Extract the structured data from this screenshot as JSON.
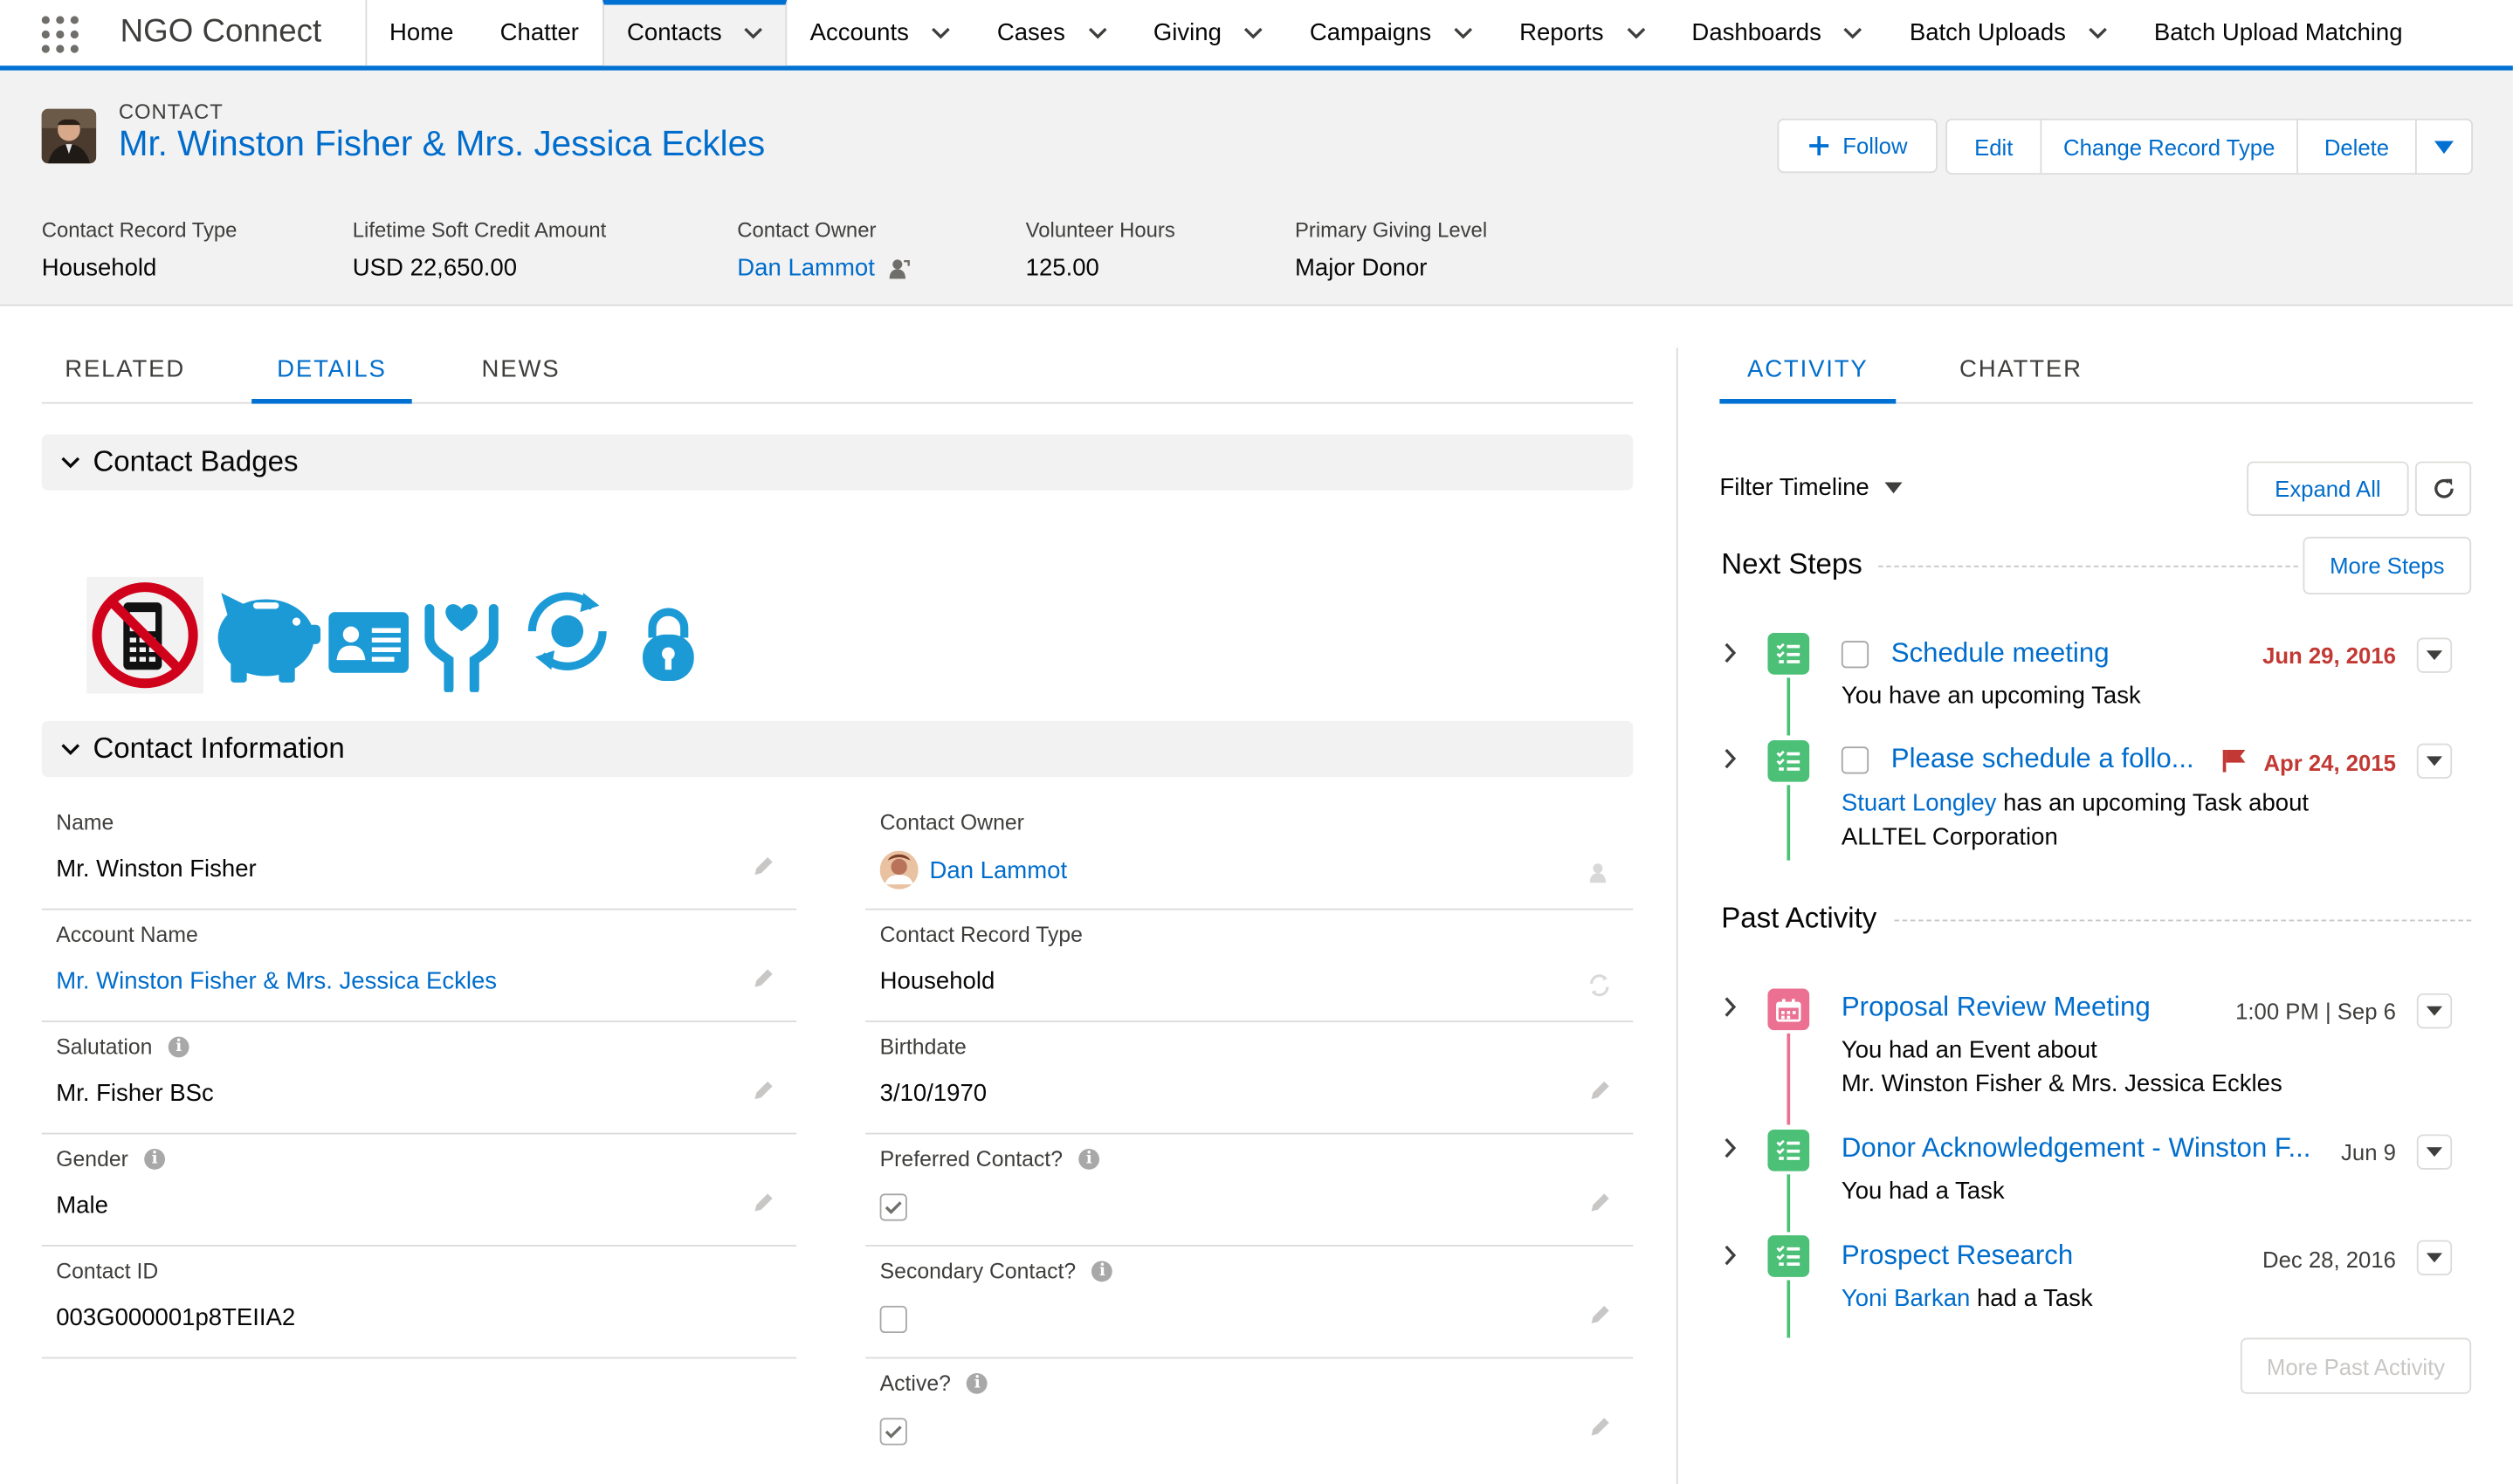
{
  "app": {
    "name": "NGO Connect"
  },
  "nav": {
    "items": [
      {
        "label": "Home",
        "dropdown": false
      },
      {
        "label": "Chatter",
        "dropdown": false
      },
      {
        "label": "Contacts",
        "dropdown": true,
        "active": true
      },
      {
        "label": "Accounts",
        "dropdown": true
      },
      {
        "label": "Cases",
        "dropdown": true
      },
      {
        "label": "Giving",
        "dropdown": true
      },
      {
        "label": "Campaigns",
        "dropdown": true
      },
      {
        "label": "Reports",
        "dropdown": true
      },
      {
        "label": "Dashboards",
        "dropdown": true
      },
      {
        "label": "Batch Uploads",
        "dropdown": true
      },
      {
        "label": "Batch Upload Matching",
        "dropdown": false
      }
    ]
  },
  "record": {
    "type_label": "CONTACT",
    "name": "Mr. Winston Fisher & Mrs. Jessica Eckles",
    "actions": {
      "follow": "Follow",
      "edit": "Edit",
      "change_record_type": "Change Record Type",
      "delete": "Delete"
    }
  },
  "highlights": [
    {
      "label": "Contact Record Type",
      "value": "Household"
    },
    {
      "label": "Lifetime Soft Credit Amount",
      "value": "USD 22,650.00"
    },
    {
      "label": "Contact Owner",
      "value": "Dan Lammot"
    },
    {
      "label": "Volunteer Hours",
      "value": "125.00"
    },
    {
      "label": "Primary Giving Level",
      "value": "Major Donor"
    }
  ],
  "left_tabs": [
    {
      "label": "RELATED"
    },
    {
      "label": "DETAILS",
      "active": true
    },
    {
      "label": "NEWS"
    }
  ],
  "sections": {
    "badges": "Contact Badges",
    "info": "Contact Information"
  },
  "badges": [
    "no-mobile-icon",
    "piggy-bank-icon",
    "id-card-icon",
    "charity-hands-icon",
    "recurring-sync-icon",
    "lock-icon"
  ],
  "fields": {
    "name": {
      "label": "Name",
      "value": "Mr. Winston Fisher"
    },
    "owner": {
      "label": "Contact Owner",
      "value": "Dan Lammot"
    },
    "account": {
      "label": "Account Name",
      "value": "Mr. Winston Fisher & Mrs. Jessica Eckles"
    },
    "record_type": {
      "label": "Contact Record Type",
      "value": "Household"
    },
    "salutation": {
      "label": "Salutation",
      "value": "Mr. Fisher BSc"
    },
    "birthdate": {
      "label": "Birthdate",
      "value": "3/10/1970"
    },
    "gender": {
      "label": "Gender",
      "value": "Male"
    },
    "preferred": {
      "label": "Preferred Contact?",
      "checked": true
    },
    "contact_id": {
      "label": "Contact ID",
      "value": "003G000001p8TEIIA2"
    },
    "secondary": {
      "label": "Secondary Contact?",
      "checked": false
    },
    "active": {
      "label": "Active?",
      "checked": true
    }
  },
  "right_tabs": [
    {
      "label": "ACTIVITY",
      "active": true
    },
    {
      "label": "CHATTER"
    }
  ],
  "activity": {
    "filter": "Filter Timeline",
    "expand_all": "Expand All",
    "next_steps": "Next Steps",
    "more_steps": "More Steps",
    "past_activity": "Past Activity",
    "more_past": "More Past Activity",
    "upcoming": [
      {
        "title": "Schedule meeting",
        "date": "Jun 29, 2016",
        "sub": "You have an upcoming Task"
      },
      {
        "title": "Please schedule a follo...",
        "date": "Apr 24, 2015",
        "sub_link": "Stuart Longley",
        "sub_text": "has an upcoming Task about",
        "sub_link2": "ALLTEL Corporation"
      }
    ],
    "past": [
      {
        "title": "Proposal Review Meeting",
        "date": "1:00 PM | Sep 6",
        "sub": "You had an Event about",
        "sub_link": "Mr. Winston Fisher & Mrs. Jessica Eckles"
      },
      {
        "title": "Donor Acknowledgement - Winston F...",
        "date": "Jun 9",
        "sub": "You had a Task"
      },
      {
        "title": "Prospect Research",
        "date": "Dec 28, 2016",
        "sub_link": "Yoni Barkan",
        "sub_text": "had a Task"
      }
    ]
  },
  "colors": {
    "brand": "#0070d2",
    "link": "#006dcc",
    "task": "#4bc076",
    "event": "#eb7092",
    "overdue": "#c23934"
  }
}
